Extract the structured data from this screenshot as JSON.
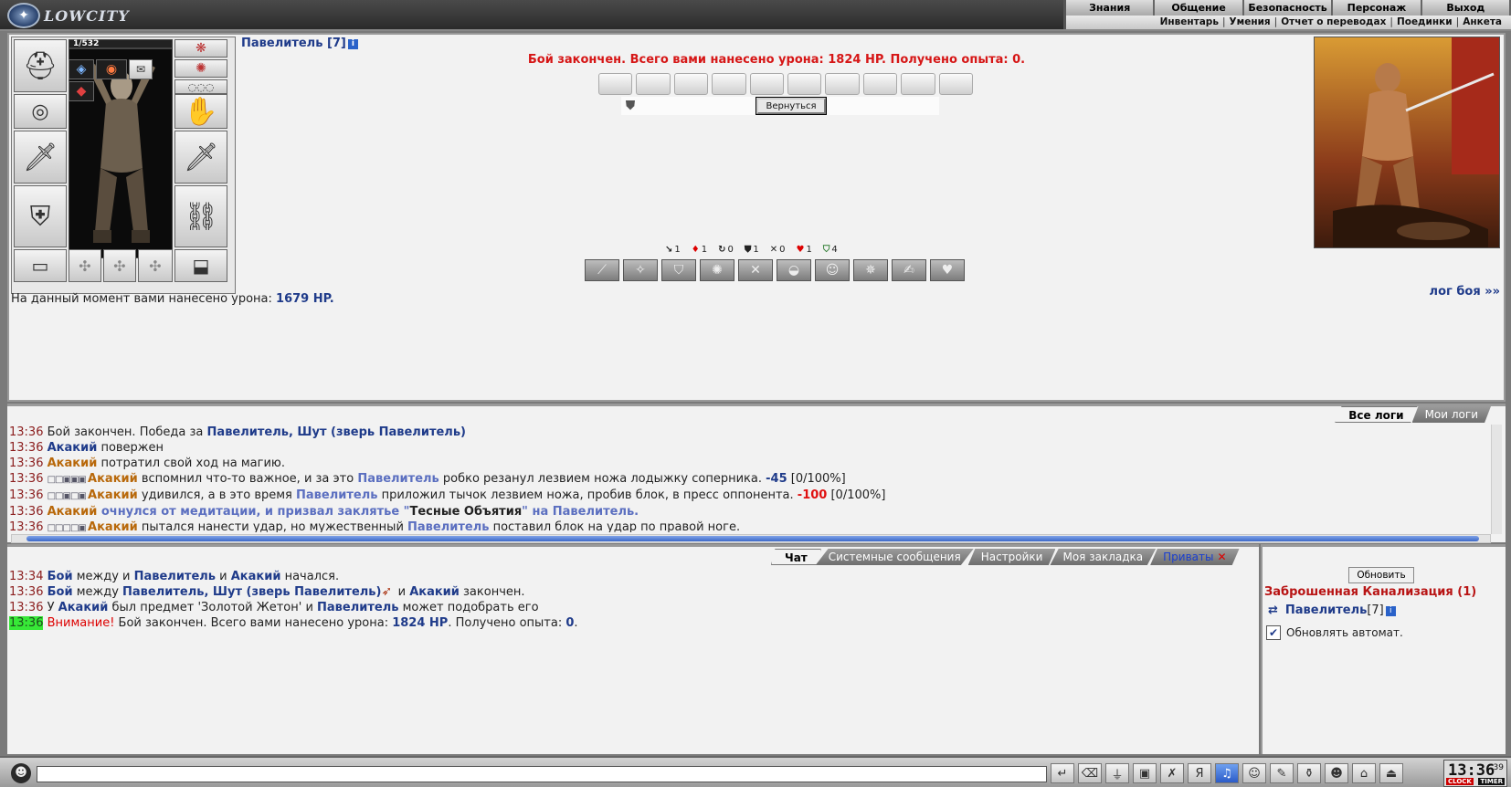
{
  "app": {
    "logo_text": "LOWCITY"
  },
  "top_menu": {
    "main": [
      "Знания",
      "Общение",
      "Безопасность",
      "Персонаж",
      "Выход"
    ],
    "sub": [
      "Инвентарь",
      "Умения",
      "Отчет о переводах",
      "Поединки",
      "Анкета"
    ]
  },
  "character": {
    "name_label": "Павелитель [7]",
    "info_icon": "i",
    "hp_text": "1/532"
  },
  "battle": {
    "result_message": "Бой закончен. Всего вами нанесено урона: 1824 HP. Получено опыта: 0.",
    "return_button": "Вернуться",
    "stats": [
      {
        "icon": "↘",
        "value": "1"
      },
      {
        "icon": "♦",
        "value": "1"
      },
      {
        "icon": "↻",
        "value": "0"
      },
      {
        "icon": "⛊",
        "value": "1"
      },
      {
        "icon": "✕",
        "value": "0"
      },
      {
        "icon": "♥",
        "value": "1"
      },
      {
        "icon": "⛉",
        "value": "4"
      }
    ],
    "damage_now_prefix": "На данный момент вами нанесено урона:",
    "damage_now_value": "1679 HP.",
    "log_link": "лог боя »»"
  },
  "log_tabs": {
    "all": "Все логи",
    "mine": "Мои логи"
  },
  "log_lines": [
    {
      "time": "13:36",
      "parts": [
        [
          "t",
          "Бой закончен. Победа за "
        ],
        [
          "blue",
          "Павелитель, Шут (зверь Павелитель)"
        ]
      ]
    },
    {
      "time": "13:36",
      "parts": [
        [
          "blue",
          "Акакий"
        ],
        [
          "t",
          " повержен"
        ]
      ]
    },
    {
      "time": "13:36",
      "parts": [
        [
          "orange",
          "Акакий"
        ],
        [
          "t",
          " потратил свой ход на магию."
        ]
      ]
    },
    {
      "time": "13:36",
      "parts": [
        [
          "boxes",
          "□□▣▣▣ "
        ],
        [
          "orange",
          "Акакий"
        ],
        [
          "t",
          " вспомнил что-то важное, и за это "
        ],
        [
          "lblue",
          "Павелитель"
        ],
        [
          "t",
          " робко резанул лезвием ножа лодыжку соперника. "
        ],
        [
          "negblue",
          "-45"
        ],
        [
          "t",
          " [0/100%]"
        ]
      ]
    },
    {
      "time": "13:36",
      "parts": [
        [
          "boxes",
          "□□▣□▣ "
        ],
        [
          "orange",
          "Акакий"
        ],
        [
          "t",
          " удивился, а в это время "
        ],
        [
          "lblue",
          "Павелитель"
        ],
        [
          "t",
          " приложил тычок лезвием ножа, пробив блок, в пресс оппонента. "
        ],
        [
          "neg",
          "-100"
        ],
        [
          "t",
          " [0/100%]"
        ]
      ]
    },
    {
      "time": "13:36",
      "parts": [
        [
          "orange",
          "Акакий"
        ],
        [
          "lblue",
          " очнулся от медитации, и призвал заклятье \""
        ],
        [
          "bold",
          "Тесные Объятия"
        ],
        [
          "lblue",
          "\" на "
        ],
        [
          "lblue",
          "Павелитель."
        ]
      ]
    },
    {
      "time": "13:36",
      "parts": [
        [
          "boxes",
          "□□□□▣ "
        ],
        [
          "orange",
          "Акакий"
        ],
        [
          "t",
          " пытался нанести удар, но мужественный "
        ],
        [
          "lblue",
          "Павелитель"
        ],
        [
          "t",
          " поставил блок на удар по правой ноге."
        ]
      ]
    }
  ],
  "chat_tabs": [
    "Чат",
    "Системные сообщения",
    "Настройки",
    "Моя закладка",
    "Приваты"
  ],
  "chat_close": "✕",
  "chat_lines": [
    {
      "time": "13:34",
      "parts": [
        [
          "blue",
          "Бой"
        ],
        [
          "t",
          " между и "
        ],
        [
          "blue",
          "Павелитель"
        ],
        [
          "t",
          " и "
        ],
        [
          "blue",
          "Акакий"
        ],
        [
          "t",
          " начался."
        ]
      ]
    },
    {
      "time": "13:36",
      "parts": [
        [
          "blue",
          "Бой"
        ],
        [
          "t",
          " между "
        ],
        [
          "blue",
          "Павелитель, Шут (зверь Павелитель)"
        ],
        [
          "arrow",
          ""
        ],
        [
          "t",
          " и "
        ],
        [
          "blue",
          "Акакий"
        ],
        [
          "t",
          " закончен."
        ]
      ]
    },
    {
      "time": "13:36",
      "parts": [
        [
          "t",
          "У "
        ],
        [
          "blue",
          "Акакий"
        ],
        [
          "t",
          " был предмет 'Золотой Жетон' и "
        ],
        [
          "blue",
          "Павелитель"
        ],
        [
          "t",
          " может подобрать его"
        ]
      ]
    },
    {
      "time": "13:36",
      "highlight": true,
      "parts": [
        [
          "warn",
          "Внимание!"
        ],
        [
          "t",
          " Бой закончен. Всего вами нанесено урона: "
        ],
        [
          "blue",
          "1824 HP"
        ],
        [
          "t",
          ". Получено опыта: "
        ],
        [
          "blue",
          "0"
        ],
        [
          "t",
          "."
        ]
      ]
    }
  ],
  "side": {
    "refresh_button": "Обновить",
    "location": "Заброшенная Канализация (1)",
    "user_name": "Павелитель",
    "user_level": "[7]",
    "auto_refresh_label": "Обновлять автомат."
  },
  "clock": {
    "time": "13:36",
    "seconds": "39",
    "label_clock": "CLOCK",
    "label_timer": "TIMER"
  }
}
